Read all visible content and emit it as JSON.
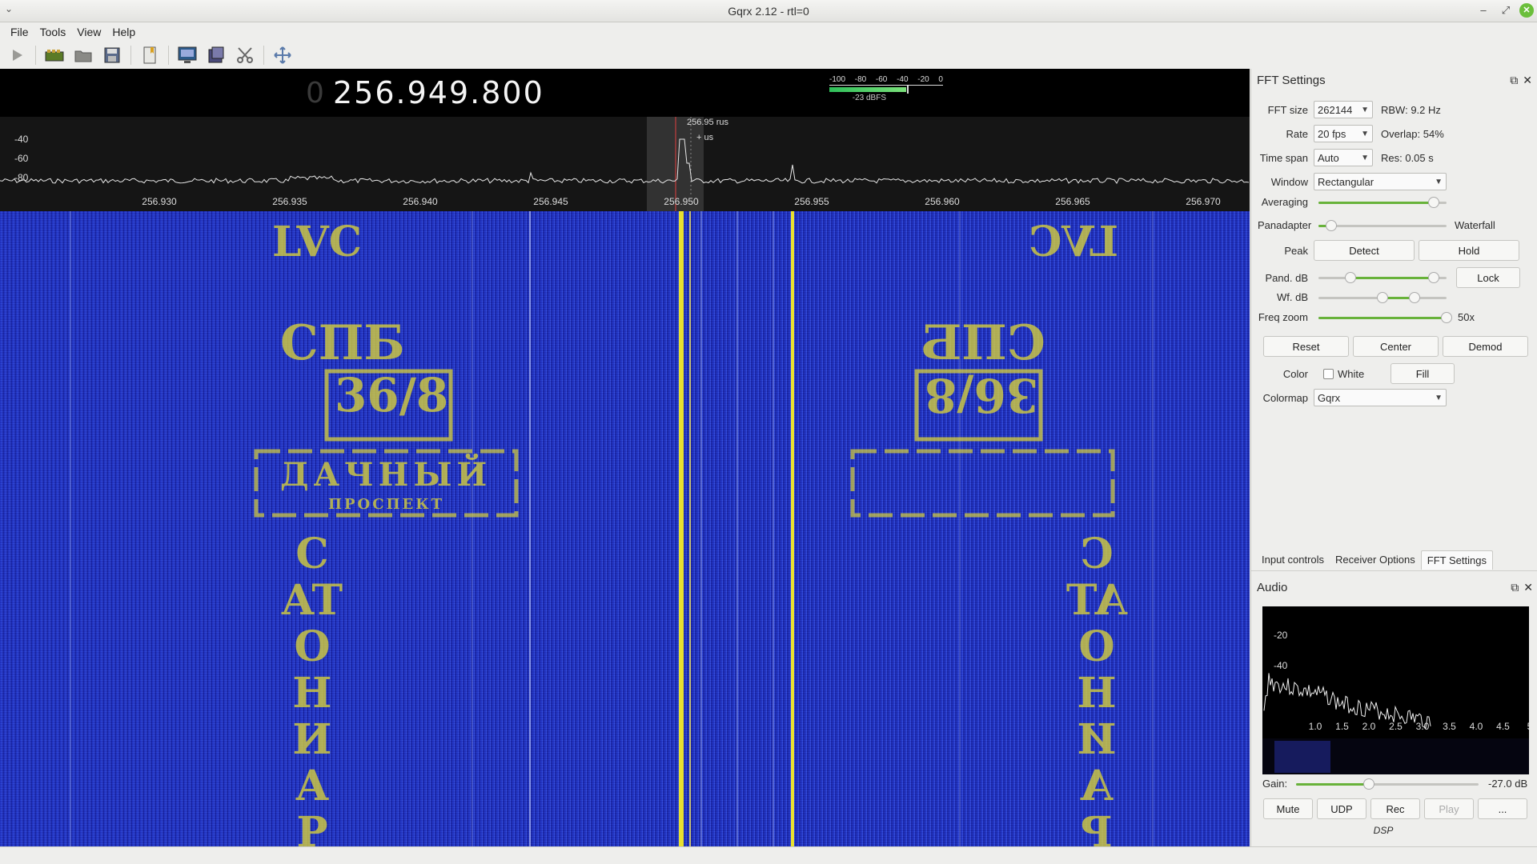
{
  "window": {
    "title": "Gqrx 2.12 - rtl=0"
  },
  "menu": [
    "File",
    "Tools",
    "View",
    "Help"
  ],
  "toolbar": {
    "icons": [
      "play-icon",
      "hardware-icon",
      "open-icon",
      "save-icon",
      "bookmark-icon",
      "screen-icon",
      "io-icon",
      "scissors-icon",
      "fullscreen-icon"
    ]
  },
  "freq": {
    "prefix": "0",
    "value": "256.949.800"
  },
  "meter": {
    "scale": [
      "-100",
      "-80",
      "-60",
      "-40",
      "-20",
      "0"
    ],
    "level_label": "-23 dBFS",
    "level_fraction": 0.68
  },
  "pana": {
    "ylabels": [
      "-40",
      "-60",
      "-80"
    ],
    "xlabels": [
      "256.930",
      "256.935",
      "256.940",
      "256.945",
      "256.950",
      "256.955",
      "256.960",
      "256.965",
      "256.970"
    ],
    "marker_label": "256.95 rus",
    "marker_label2": "+ us"
  },
  "waterfall": {
    "stamp_left": {
      "top": "LVC",
      "mid": "CПБ",
      "box": "36/8",
      "plate1": "ДАЧНЫЙ",
      "plate2": "ПРОСПЕКТ",
      "bottom": "CATO НИАР"
    }
  },
  "fft": {
    "title": "FFT Settings",
    "fft_size_label": "FFT size",
    "fft_size": "262144",
    "rbw": "RBW: 9.2 Hz",
    "rate_label": "Rate",
    "rate": "20 fps",
    "overlap": "Overlap: 54%",
    "timespan_label": "Time span",
    "timespan": "Auto",
    "res": "Res: 0.05 s",
    "window_label": "Window",
    "window": "Rectangular",
    "averaging_label": "Averaging",
    "averaging": 0.9,
    "panadapter_label": "Panadapter",
    "waterfall_label": "Waterfall",
    "pan_split": 0.1,
    "peak_label": "Peak",
    "detect": "Detect",
    "hold": "Hold",
    "pand_db_label": "Pand. dB",
    "pand_db_lo": 0.25,
    "pand_db_hi": 0.9,
    "lock": "Lock",
    "wf_db_label": "Wf. dB",
    "wf_db_lo": 0.5,
    "wf_db_hi": 0.75,
    "freqzoom_label": "Freq zoom",
    "freqzoom": "50x",
    "freqzoom_val": 1.0,
    "reset": "Reset",
    "center": "Center",
    "demod": "Demod",
    "color_label": "Color",
    "white": "White",
    "fill": "Fill",
    "colormap_label": "Colormap",
    "colormap": "Gqrx"
  },
  "tabs": [
    "Input controls",
    "Receiver Options",
    "FFT Settings"
  ],
  "audio": {
    "title": "Audio",
    "ylabels": [
      "-20",
      "-40"
    ],
    "xlabels": [
      "1.0",
      "1.5",
      "2.0",
      "2.5",
      "3.0",
      "3.5",
      "4.0",
      "4.5",
      "5"
    ],
    "gain_label": "Gain:",
    "gain": "-27.0 dB",
    "gain_val": 0.4,
    "buttons": [
      "Mute",
      "UDP",
      "Rec",
      "Play",
      "..."
    ],
    "dsp": "DSP"
  },
  "colors": {
    "accent": "#68b23a",
    "waterfall": "#2a3ad0",
    "signal": "#e8e030"
  }
}
